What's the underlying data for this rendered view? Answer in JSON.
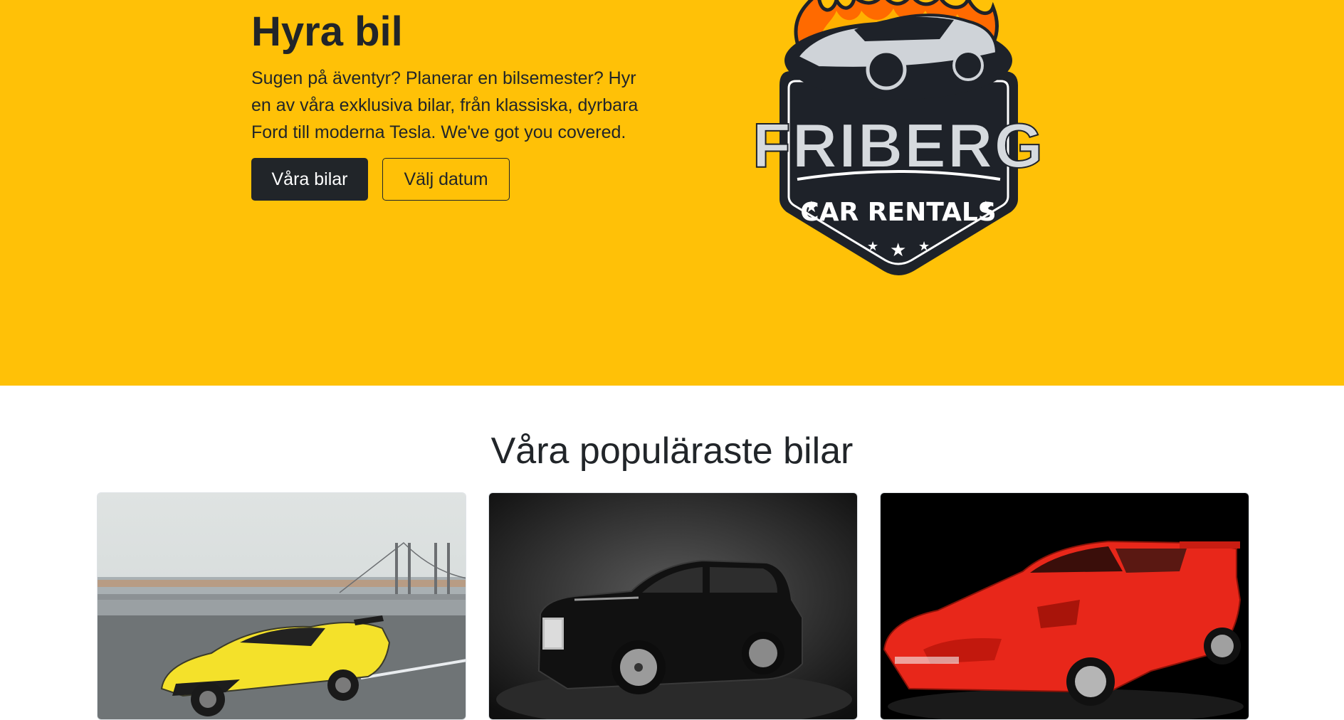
{
  "hero": {
    "title": "Hyra bil",
    "lead": "Sugen på äventyr? Planerar en bilsemester? Hyr en av våra exklusiva bilar, från klassiska, dyrbara Ford till moderna Tesla. We've got you covered.",
    "primary_button": "Våra bilar",
    "secondary_button": "Välj datum",
    "background_color": "#ffc107"
  },
  "logo": {
    "brand": "FRIBERG",
    "tagline": "CAR RENTALS"
  },
  "popular": {
    "heading": "Våra populäraste bilar",
    "cards": [
      {
        "image": "yellow-sports-car-photo"
      },
      {
        "image": "black-luxury-suv-photo"
      },
      {
        "image": "red-classic-sports-car-photo"
      }
    ]
  },
  "colors": {
    "dark": "#212529",
    "yellow": "#ffc107"
  }
}
